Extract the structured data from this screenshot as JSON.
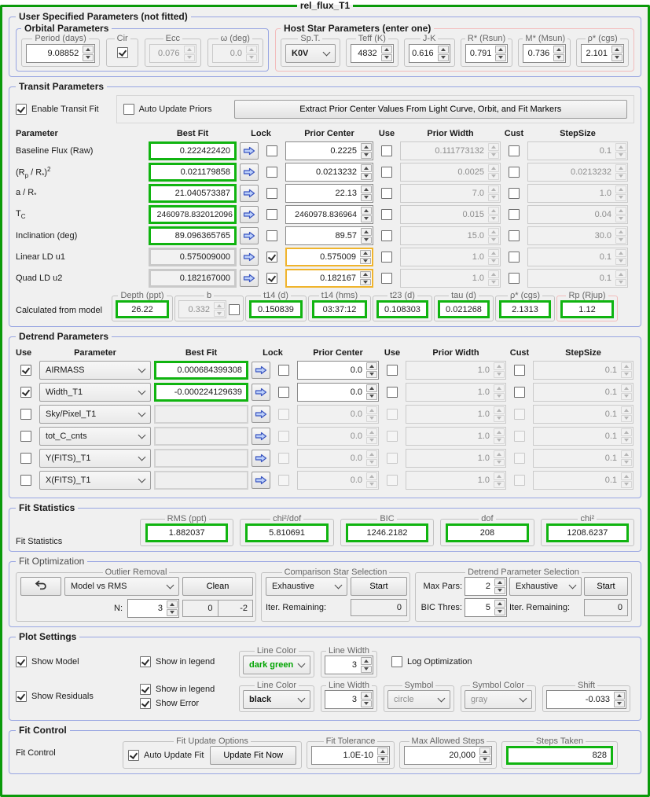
{
  "window": {
    "title": "rel_flux_T1"
  },
  "colors": {
    "window_border": "#0a9a0a",
    "section_border": "#98a5e2",
    "pink_border": "#f2bcbc",
    "green_box_border": "#10b410",
    "yellow_box_border": "#f0b42c",
    "dark_green_text": "#00a400"
  },
  "user_params": {
    "title": "User Specified Parameters (not fitted)",
    "orbital": {
      "title": "Orbital Parameters",
      "period": {
        "label": "Period (days)",
        "value": "9.08852"
      },
      "cir": {
        "label": "Cir",
        "checked": true
      },
      "ecc": {
        "label": "Ecc",
        "value": "0.076"
      },
      "omega": {
        "label": "ω (deg)",
        "value": "0.0"
      }
    },
    "host_star": {
      "title": "Host Star Parameters (enter one)",
      "sp_t": {
        "label": "Sp.T.",
        "value": "K0V"
      },
      "teff": {
        "label": "Teff (K)",
        "value": "4832"
      },
      "j_k": {
        "label": "J-K",
        "value": "0.616"
      },
      "r_star": {
        "label": "R* (Rsun)",
        "value": "0.791"
      },
      "m_star": {
        "label": "M* (Msun)",
        "value": "0.736"
      },
      "rho_star": {
        "label": "ρ* (cgs)",
        "value": "2.101"
      }
    }
  },
  "transit": {
    "title": "Transit Parameters",
    "enable_fit": {
      "label": "Enable Transit Fit",
      "checked": true
    },
    "auto_update_priors": {
      "label": "Auto Update Priors",
      "checked": false
    },
    "extract_button": "Extract Prior Center Values From Light Curve, Orbit, and Fit Markers",
    "headers": {
      "parameter": "Parameter",
      "best_fit": "Best Fit",
      "lock": "Lock",
      "prior_center": "Prior Center",
      "use": "Use",
      "prior_width": "Prior Width",
      "cust": "Cust",
      "stepsize": "StepSize"
    },
    "rows": [
      {
        "label_html": "Baseline Flux (Raw)",
        "best_fit": "0.222422420",
        "lock_checked": false,
        "prior_center": "0.2225",
        "use_checked": false,
        "prior_width": "0.111773132",
        "cust_checked": false,
        "stepsize": "0.1"
      },
      {
        "label_html": "(R<sub>p</sub> / R<sub>*</sub>)<sup>2</sup>",
        "best_fit": "0.021179858",
        "lock_checked": false,
        "prior_center": "0.0213232",
        "use_checked": false,
        "prior_width": "0.0025",
        "cust_checked": false,
        "stepsize": "0.0213232"
      },
      {
        "label_html": "a / R<sub>*</sub>",
        "best_fit": "21.040573387",
        "lock_checked": false,
        "prior_center": "22.13",
        "use_checked": false,
        "prior_width": "7.0",
        "cust_checked": false,
        "stepsize": "1.0"
      },
      {
        "label_html": "T<sub>C</sub>",
        "best_fit": "2460978.832012096",
        "lock_checked": false,
        "prior_center": "2460978.836964",
        "use_checked": false,
        "prior_width": "0.015",
        "cust_checked": false,
        "stepsize": "0.04"
      },
      {
        "label_html": "Inclination (deg)",
        "best_fit": "89.096365765",
        "lock_checked": false,
        "prior_center": "89.57",
        "use_checked": false,
        "prior_width": "15.0",
        "cust_checked": false,
        "stepsize": "30.0"
      },
      {
        "label_html": "Linear LD u1",
        "best_fit": "0.575009000",
        "lock_checked": true,
        "prior_center": "0.575009",
        "use_checked": false,
        "prior_width": "1.0",
        "cust_checked": false,
        "stepsize": "0.1"
      },
      {
        "label_html": "Quad LD u2",
        "best_fit": "0.182167000",
        "lock_checked": true,
        "prior_center": "0.182167",
        "use_checked": false,
        "prior_width": "1.0",
        "cust_checked": false,
        "stepsize": "0.1"
      }
    ],
    "calculated": {
      "label": "Calculated from model",
      "depth": {
        "label": "Depth (ppt)",
        "value": "26.22"
      },
      "b": {
        "label": "b",
        "value": "0.332",
        "checked": false
      },
      "t14_d": {
        "label": "t14 (d)",
        "value": "0.150839"
      },
      "t14_hms": {
        "label": "t14 (hms)",
        "value": "03:37:12"
      },
      "t23_d": {
        "label": "t23 (d)",
        "value": "0.108303"
      },
      "tau_d": {
        "label": "tau (d)",
        "value": "0.021268"
      },
      "rho_star": {
        "label": "ρ* (cgs)",
        "value": "2.1313"
      },
      "rp": {
        "label": "Rp (Rjup)",
        "value": "1.12"
      }
    }
  },
  "detrend": {
    "title": "Detrend Parameters",
    "headers": {
      "use": "Use",
      "parameter": "Parameter",
      "best_fit": "Best Fit",
      "lock": "Lock",
      "prior_center": "Prior Center",
      "use2": "Use",
      "prior_width": "Prior Width",
      "cust": "Cust",
      "stepsize": "StepSize"
    },
    "rows": [
      {
        "use_checked": true,
        "parameter": "AIRMASS",
        "best_fit": "0.000684399308",
        "enabled": true,
        "lock_checked": false,
        "prior_center": "0.0",
        "use2_checked": false,
        "prior_width": "1.0",
        "cust_checked": false,
        "stepsize": "0.1"
      },
      {
        "use_checked": true,
        "parameter": "Width_T1",
        "best_fit": "-0.000224129639",
        "enabled": true,
        "lock_checked": false,
        "prior_center": "0.0",
        "use2_checked": false,
        "prior_width": "1.0",
        "cust_checked": false,
        "stepsize": "0.1"
      },
      {
        "use_checked": false,
        "parameter": "Sky/Pixel_T1",
        "best_fit": "",
        "enabled": false,
        "lock_checked": false,
        "prior_center": "0.0",
        "use2_checked": false,
        "prior_width": "1.0",
        "cust_checked": false,
        "stepsize": "0.1"
      },
      {
        "use_checked": false,
        "parameter": "tot_C_cnts",
        "best_fit": "",
        "enabled": false,
        "lock_checked": false,
        "prior_center": "0.0",
        "use2_checked": false,
        "prior_width": "1.0",
        "cust_checked": false,
        "stepsize": "0.1"
      },
      {
        "use_checked": false,
        "parameter": "Y(FITS)_T1",
        "best_fit": "",
        "enabled": false,
        "lock_checked": false,
        "prior_center": "0.0",
        "use2_checked": false,
        "prior_width": "1.0",
        "cust_checked": false,
        "stepsize": "0.1"
      },
      {
        "use_checked": false,
        "parameter": "X(FITS)_T1",
        "best_fit": "",
        "enabled": false,
        "lock_checked": false,
        "prior_center": "0.0",
        "use2_checked": false,
        "prior_width": "1.0",
        "cust_checked": false,
        "stepsize": "0.1"
      }
    ]
  },
  "fit_statistics": {
    "title": "Fit Statistics",
    "label": "Fit Statistics",
    "stats": [
      {
        "label": "RMS (ppt)",
        "value": "1.882037"
      },
      {
        "label": "chi²/dof",
        "value": "5.810691"
      },
      {
        "label": "BIC",
        "value": "1246.2182"
      },
      {
        "label": "dof",
        "value": "208"
      },
      {
        "label": "chi²",
        "value": "1208.6237"
      }
    ]
  },
  "fit_optimization": {
    "title": "Fit Optimization",
    "outlier_removal": {
      "title": "Outlier Removal",
      "method_value": "Model vs RMS",
      "clean_button": "Clean",
      "n_label": "N:",
      "n_value": "3",
      "removed": "0",
      "delta": "-2"
    },
    "comparison": {
      "title": "Comparison Star Selection",
      "method_value": "Exhaustive",
      "start_button": "Start",
      "iter_label": "Iter. Remaining:",
      "iter_value": "0"
    },
    "detrend_selection": {
      "title": "Detrend Parameter Selection",
      "max_pars_label": "Max Pars:",
      "max_pars_value": "2",
      "method_value": "Exhaustive",
      "start_button": "Start",
      "bic_label": "BIC Thres:",
      "bic_value": "5",
      "iter_label": "Iter. Remaining:",
      "iter_value": "0"
    }
  },
  "plot_settings": {
    "title": "Plot Settings",
    "model": {
      "show": {
        "label": "Show Model",
        "checked": true
      },
      "legend": {
        "label": "Show in legend",
        "checked": true
      },
      "line_color": {
        "title": "Line Color",
        "value": "dark green"
      },
      "line_width": {
        "title": "Line Width",
        "value": "3"
      },
      "log_optimization": {
        "label": "Log Optimization",
        "checked": false
      }
    },
    "residuals": {
      "show": {
        "label": "Show Residuals",
        "checked": true
      },
      "legend": {
        "label": "Show in legend",
        "checked": true
      },
      "error": {
        "label": "Show Error",
        "checked": true
      },
      "line_color": {
        "title": "Line Color",
        "value": "black"
      },
      "line_width": {
        "title": "Line Width",
        "value": "3"
      },
      "symbol": {
        "title": "Symbol",
        "value": "circle"
      },
      "symbol_color": {
        "title": "Symbol Color",
        "value": "gray"
      },
      "shift": {
        "title": "Shift",
        "value": "-0.033"
      }
    }
  },
  "fit_control": {
    "title": "Fit Control",
    "label": "Fit Control",
    "update_options": {
      "title": "Fit Update Options",
      "auto_update_label": "Auto Update Fit",
      "auto_update_checked": true,
      "update_now_button": "Update Fit Now"
    },
    "tolerance": {
      "title": "Fit Tolerance",
      "value": "1.0E-10"
    },
    "max_steps": {
      "title": "Max Allowed Steps",
      "value": "20,000"
    },
    "steps_taken": {
      "title": "Steps Taken",
      "value": "828"
    }
  }
}
